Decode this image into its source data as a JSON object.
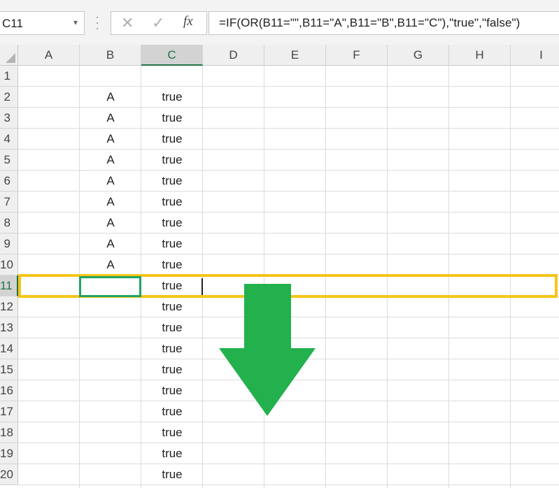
{
  "name_box": {
    "value": "C11"
  },
  "formula_bar": {
    "cancel_glyph": "✕",
    "enter_glyph": "✓",
    "fx_label": "fx",
    "formula": "=IF(OR(B11=\"\",B11=\"A\",B11=\"B\",B11=\"C\"),\"true\",\"false\")"
  },
  "columns": [
    "A",
    "B",
    "C",
    "D",
    "E",
    "F",
    "G",
    "H",
    "I"
  ],
  "selected_column": "C",
  "selected_row": 11,
  "rows": [
    {
      "n": "1",
      "b": "",
      "c": ""
    },
    {
      "n": "2",
      "b": "A",
      "c": "true"
    },
    {
      "n": "3",
      "b": "A",
      "c": "true"
    },
    {
      "n": "4",
      "b": "A",
      "c": "true"
    },
    {
      "n": "5",
      "b": "A",
      "c": "true"
    },
    {
      "n": "6",
      "b": "A",
      "c": "true"
    },
    {
      "n": "7",
      "b": "A",
      "c": "true"
    },
    {
      "n": "8",
      "b": "A",
      "c": "true"
    },
    {
      "n": "9",
      "b": "A",
      "c": "true"
    },
    {
      "n": "10",
      "b": "A",
      "c": "true"
    },
    {
      "n": "11",
      "b": "",
      "c": "true"
    },
    {
      "n": "12",
      "b": "",
      "c": "true"
    },
    {
      "n": "13",
      "b": "",
      "c": "true"
    },
    {
      "n": "14",
      "b": "",
      "c": "true"
    },
    {
      "n": "15",
      "b": "",
      "c": "true"
    },
    {
      "n": "16",
      "b": "",
      "c": "true"
    },
    {
      "n": "17",
      "b": "",
      "c": "true"
    },
    {
      "n": "18",
      "b": "",
      "c": "true"
    },
    {
      "n": "19",
      "b": "",
      "c": "true"
    },
    {
      "n": "20",
      "b": "",
      "c": "true"
    }
  ],
  "annotations": {
    "highlight_color": "#f5c518",
    "arrow_color": "#22b14c",
    "active_cell_color": "#21a366",
    "arrow_icon": "down-arrow-icon"
  }
}
